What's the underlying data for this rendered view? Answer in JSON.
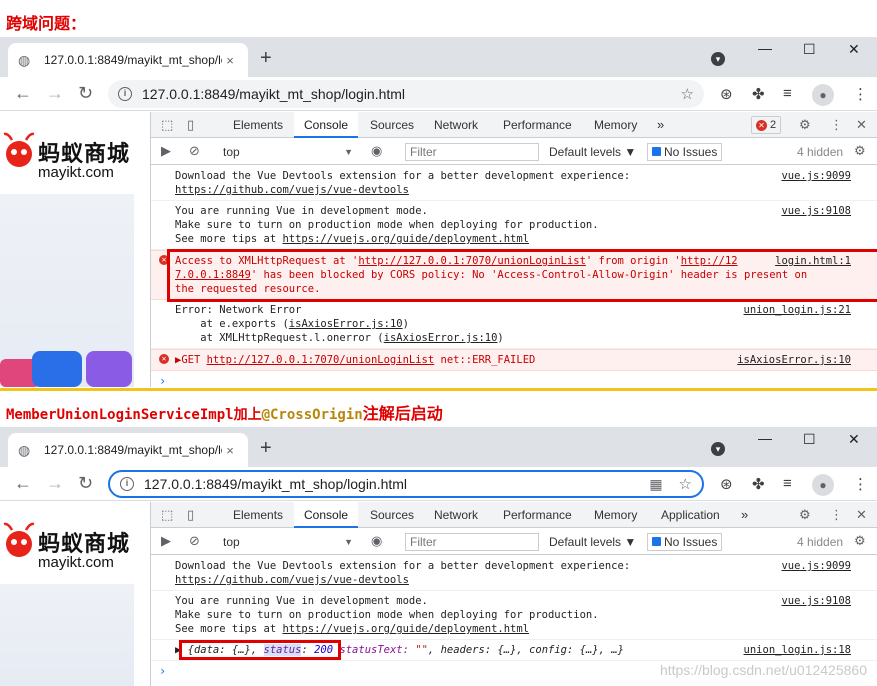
{
  "captions": {
    "top": "跨域问题：",
    "middle_prefix": "MemberUnionLoginServiceImpl加上",
    "middle_highlight": "@CrossOrigin",
    "middle_suffix": "注解后启动"
  },
  "browser": {
    "tab_title": "127.0.0.1:8849/mayikt_mt_shop/login.html",
    "url": "127.0.0.1:8849/mayikt_mt_shop/login.html",
    "new_tab": "+",
    "close_tab": "×"
  },
  "page": {
    "logo_cn": "蚂蚁商城",
    "logo_en": "mayikt.com"
  },
  "devtools": {
    "tabs_1": [
      "Elements",
      "Console",
      "Sources",
      "Network",
      "Performance",
      "Memory"
    ],
    "tabs_2": [
      "Elements",
      "Console",
      "Sources",
      "Network",
      "Performance",
      "Memory",
      "Application"
    ],
    "active_tab": "Console",
    "error_count": "2",
    "context": "top",
    "filter_placeholder": "Filter",
    "levels": "Default levels ▼",
    "issues": "No Issues",
    "hidden": "4 hidden"
  },
  "console1": {
    "m1_line1": "Download the Vue Devtools extension for a better development experience:",
    "m1_line2": "https://github.com/vuejs/vue-devtools",
    "m1_src": "vue.js:9099",
    "m2_line1": "You are running Vue in development mode.",
    "m2_line2": "Make sure to turn on production mode when deploying for production.",
    "m2_line3a": "See more tips at ",
    "m2_line3b": "https://vuejs.org/guide/deployment.html",
    "m2_src": "vue.js:9108",
    "m3_line1a": "Access to XMLHttpRequest at '",
    "m3_line1b": "http://127.0.0.1:7070/unionLoginList",
    "m3_line1c": "' from origin '",
    "m3_line1d": "http://12",
    "m3_line2a": "7.0.0.1:8849",
    "m3_line2b": "' has been blocked by CORS policy: No 'Access-Control-Allow-Origin' header is present on",
    "m3_line3": "the requested resource.",
    "m3_src": "login.html:1",
    "m4_line1": "Error: Network Error",
    "m4_line2a": "    at e.exports (",
    "m4_line2b": "isAxiosError.js:10",
    "m4_line2c": ")",
    "m4_line3a": "    at XMLHttpRequest.l.onerror (",
    "m4_line3b": "isAxiosError.js:10",
    "m4_line3c": ")",
    "m4_src": "union_login.js:21",
    "m5_a": "▶GET ",
    "m5_b": "http://127.0.0.1:7070/unionLoginList",
    "m5_c": " net::ERR_FAILED",
    "m5_src": "isAxiosError.js:10"
  },
  "console2": {
    "m3_open": "▶ {data: {…}, ",
    "m3_key": "status",
    "m3_colon": ": ",
    "m3_val": "200",
    "m3_rest1": "statusText: ",
    "m3_rest2": "\"\"",
    "m3_rest3": ", headers: {…}, config: {…}, …}",
    "m3_src": "union_login.js:18"
  },
  "watermark": "https://blog.csdn.net/u012425860"
}
